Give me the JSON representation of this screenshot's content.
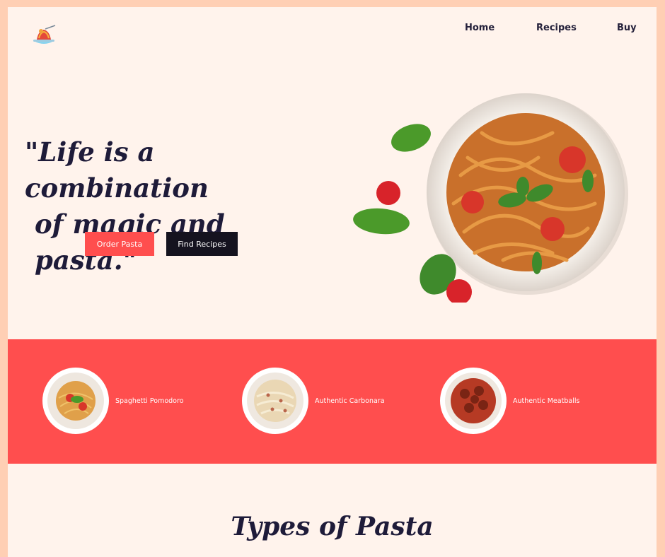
{
  "nav": {
    "logo_icon": "pasta-bowl-logo-icon",
    "items": [
      {
        "label": "Home"
      },
      {
        "label": "Recipes"
      },
      {
        "label": "Buy"
      }
    ]
  },
  "hero": {
    "quote_line1": "\"Life is a combination",
    "quote_line2": "of magic and pasta.\"",
    "order_button": "Order Pasta",
    "find_button": "Find Recipes",
    "image_icon": "pasta-plate-image"
  },
  "featured": {
    "background": "#ff4e4e",
    "dishes": [
      {
        "name": "Spaghetti Pomodoro",
        "image": "spaghetti-pomodoro-image"
      },
      {
        "name": "Authentic Carbonara",
        "image": "carbonara-image"
      },
      {
        "name": "Authentic Meatballs",
        "image": "meatballs-image"
      }
    ]
  },
  "types": {
    "title": "Types of Pasta"
  },
  "colors": {
    "accent": "#ff4e4e",
    "dark": "#15131f",
    "page_bg": "#fff3ec",
    "frame_bg": "#ffcfb4"
  }
}
